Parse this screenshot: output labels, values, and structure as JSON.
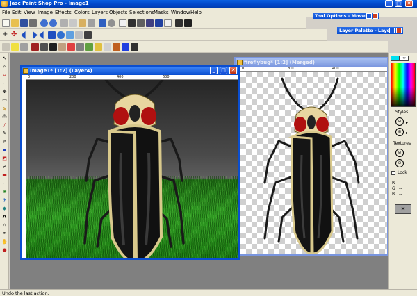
{
  "app": {
    "title": "Jasc Paint Shop Pro - Image1",
    "minimize": "_",
    "maximize": "□",
    "close": "✕"
  },
  "menu": [
    "File",
    "Edit",
    "View",
    "Image",
    "Effects",
    "Colors",
    "Layers",
    "Objects",
    "Selections",
    "Masks",
    "Window",
    "Help"
  ],
  "panels": {
    "tool_options": "Tool Options - Mover",
    "layer_palette": "Layer Palette - Layer4"
  },
  "documents": {
    "left": {
      "title": "Image1* [1:2] (Layer4)",
      "ruler": [
        "0",
        "200",
        "400",
        "600"
      ]
    },
    "right": {
      "title": "fireflybug* [1:2] (Merged)",
      "ruler": [
        "0",
        "200",
        "400"
      ]
    }
  },
  "materials": {
    "styles_label": "Styles",
    "textures_label": "Textures",
    "lock_label": "Lock",
    "readout": [
      {
        "label": "R",
        "value": "--"
      },
      {
        "label": "G",
        "value": "--"
      },
      {
        "label": "B",
        "value": "--"
      }
    ]
  },
  "status": {
    "text": "Undo the last action."
  },
  "colors": {
    "titlebar": "#0a4ed0",
    "swatch_fg": "#00e0f0",
    "swatch_bg": "#ffffff"
  }
}
